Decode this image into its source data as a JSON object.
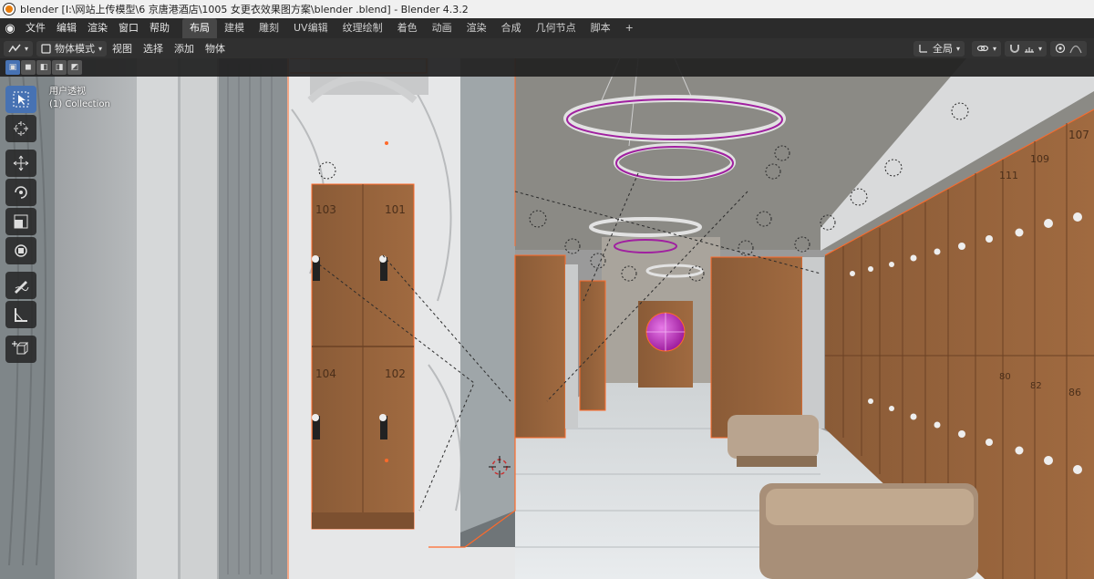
{
  "window": {
    "title": "blender  [I:\\网站上传模型\\6 京唐港酒店\\1005 女更衣效果图方案\\blender .blend] - Blender 4.3.2"
  },
  "menubar": {
    "items": [
      "文件",
      "编辑",
      "渲染",
      "窗口",
      "帮助"
    ],
    "workspaces": [
      "布局",
      "建模",
      "雕刻",
      "UV编辑",
      "纹理绘制",
      "着色",
      "动画",
      "渲染",
      "合成",
      "几何节点",
      "脚本"
    ],
    "active_workspace": "布局",
    "add_tab": "+"
  },
  "header": {
    "mode": "物体模式",
    "menus": [
      "视图",
      "选择",
      "添加",
      "物体"
    ],
    "orientation": "全局"
  },
  "viewport": {
    "view_name": "用户透视",
    "collection": "(1) Collection",
    "locker_numbers": [
      "103",
      "101",
      "104",
      "102",
      "107",
      "109",
      "111",
      "80",
      "82",
      "86"
    ]
  },
  "colors": {
    "active_blue": "#4772b3",
    "selection_orange": "#ff6a2a",
    "ring_purple": "#a020a0",
    "wood": "#8a5a36"
  },
  "tools": [
    "select-box-icon",
    "cursor-icon",
    "move-icon",
    "rotate-icon",
    "scale-icon",
    "transform-icon",
    "annotate-icon",
    "measure-icon",
    "add-cube-icon"
  ]
}
